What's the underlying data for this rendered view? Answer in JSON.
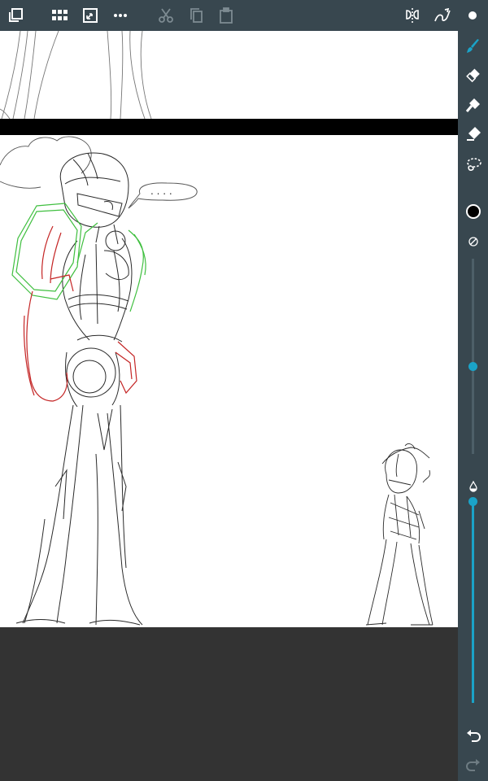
{
  "toolbar": {
    "left_icons": [
      "layers-icon",
      "gallery-grid-icon",
      "canvas-size-icon",
      "more-icon"
    ],
    "edit_icons": [
      "cut-icon",
      "copy-icon",
      "paste-icon"
    ],
    "right_icons": [
      "symmetry-icon",
      "stroke-stabilizer-icon",
      "menu-dot-icon"
    ]
  },
  "tools": {
    "items": [
      "brush-icon",
      "eraser-icon",
      "fill-icon",
      "smudge-icon",
      "lasso-icon"
    ],
    "active": "brush-icon",
    "color": "#000000",
    "accent": "#1aa3c8"
  },
  "brush": {
    "size_fraction": 0.45,
    "opacity_fraction": 1.0
  },
  "canvas": {
    "background": "#ffffff",
    "speech_bubble_text": ". . . ."
  },
  "history": {
    "undo_enabled": true,
    "redo_enabled": false
  }
}
